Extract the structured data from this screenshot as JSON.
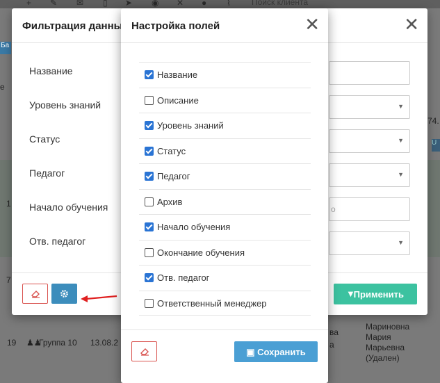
{
  "background": {
    "search_placeholder": "Поиск клиента",
    "fragments": {
      "num_74": "74.",
      "u": "U",
      "e": "e",
      "num_1": "1",
      "num_7": "7",
      "row_num": "19",
      "group": "Группа 10",
      "date": "13.08.2",
      "trunc_va": "ва",
      "trunc_a": "а",
      "teacher_line1": "Мариновна",
      "teacher_line2": "Мария",
      "teacher_line3": "Марьевна",
      "teacher_line4": "(Удален)",
      "left_tag": "Ба",
      "placeholder_o": "о"
    }
  },
  "filter_modal": {
    "title": "Фильтрация данных",
    "fields": [
      {
        "label": "Название"
      },
      {
        "label": "Уровень знаний"
      },
      {
        "label": "Статус"
      },
      {
        "label": "Педагог"
      },
      {
        "label": "Начало обучения"
      },
      {
        "label": "Отв. педагог"
      }
    ],
    "apply_label": "Применить"
  },
  "fields_modal": {
    "title": "Настройка полей",
    "items": [
      {
        "label": "Название",
        "checked": true
      },
      {
        "label": "Описание",
        "checked": false
      },
      {
        "label": "Уровень знаний",
        "checked": true
      },
      {
        "label": "Статус",
        "checked": true
      },
      {
        "label": "Педагог",
        "checked": true
      },
      {
        "label": "Архив",
        "checked": false
      },
      {
        "label": "Начало обучения",
        "checked": true
      },
      {
        "label": "Окончание обучения",
        "checked": false
      },
      {
        "label": "Отв. педагог",
        "checked": true
      },
      {
        "label": "Ответственный менеджер",
        "checked": false
      }
    ],
    "save_label": "Сохранить"
  },
  "colors": {
    "primary": "#3c8dbc",
    "save": "#4a9fd4",
    "apply": "#3cc2a0",
    "danger": "#d9534f",
    "checkbox": "#2a74d4",
    "arrow": "#e02020"
  }
}
